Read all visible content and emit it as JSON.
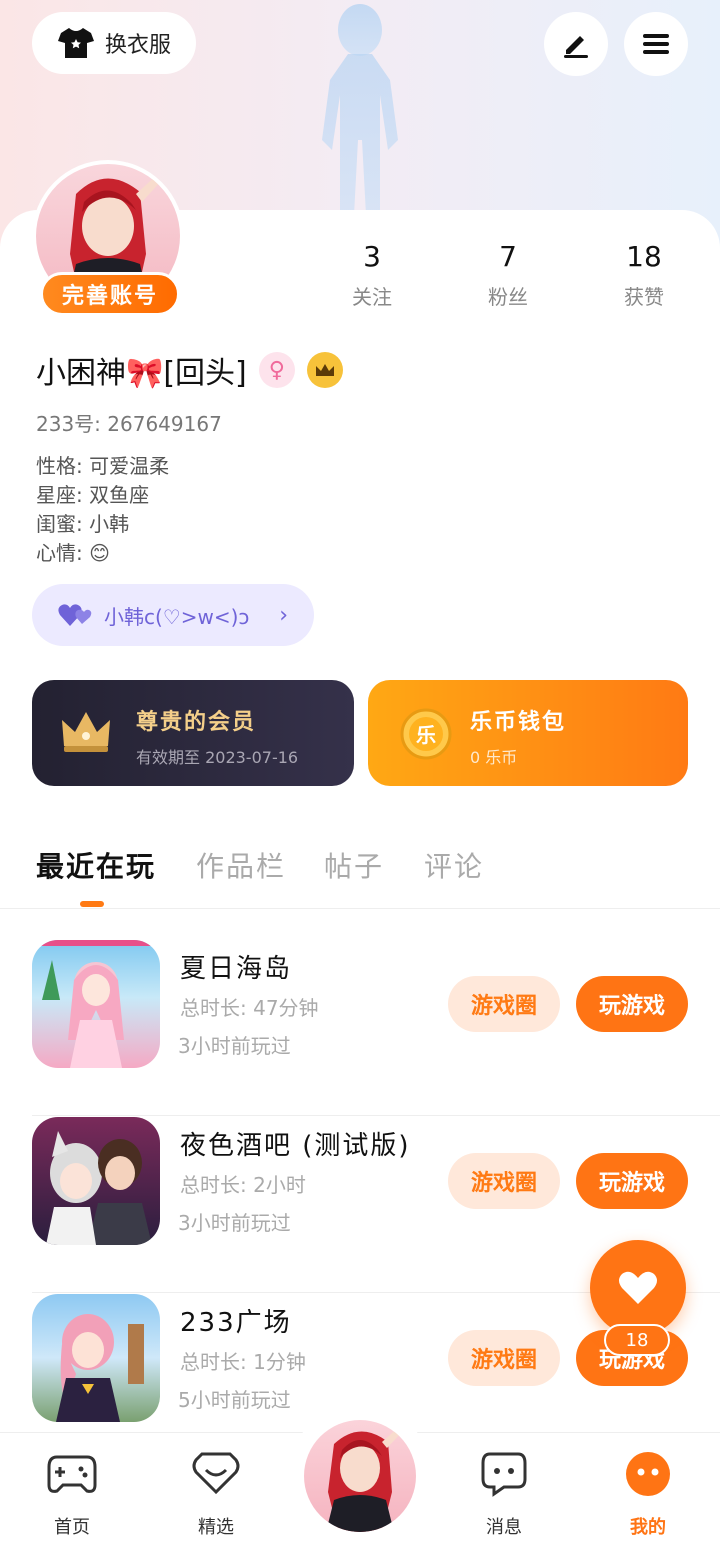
{
  "top_bar": {
    "dress_label": "换衣服"
  },
  "profile": {
    "badge": "完善账号",
    "stats": [
      {
        "value": "3",
        "label": "关注"
      },
      {
        "value": "7",
        "label": "粉丝"
      },
      {
        "value": "18",
        "label": "获赞"
      }
    ],
    "name": "小困神🎀[回头]",
    "gender_symbol": "♀",
    "uid_line": "233号: 267649167",
    "info": [
      "性格: 可爱温柔",
      "星座: 双鱼座",
      "闺蜜: 小韩",
      "心情: 😊"
    ],
    "friend_chip": "小韩c(♡>w<)ɔ",
    "chevron": "›"
  },
  "vip": {
    "title": "尊贵的会员",
    "subtitle": "有效期至 2023-07-16"
  },
  "wallet": {
    "coin_glyph": "乐",
    "title": "乐币钱包",
    "subtitle": "0 乐币"
  },
  "tabs": [
    "最近在玩",
    "作品栏",
    "帖子",
    "评论"
  ],
  "games": [
    {
      "name": "夏日海岛",
      "total": "总时长: 47分钟",
      "last": "3小时前玩过",
      "circle_btn": "游戏圈",
      "play_btn": "玩游戏"
    },
    {
      "name": "夜色酒吧 (测试版)",
      "total": "总时长: 2小时",
      "last": "3小时前玩过",
      "circle_btn": "游戏圈",
      "play_btn": "玩游戏"
    },
    {
      "name": "233广场",
      "total": "总时长: 1分钟",
      "last": "5小时前玩过",
      "circle_btn": "游戏圈",
      "play_btn": "玩游戏"
    }
  ],
  "like_fab": {
    "count": "18"
  },
  "bottom_nav": [
    {
      "label": "首页",
      "icon": "gamepad-icon"
    },
    {
      "label": "精选",
      "icon": "heart-box-icon"
    },
    {
      "label": "消息",
      "icon": "chat-icon"
    },
    {
      "label": "我的",
      "icon": "smile-icon"
    }
  ],
  "colors": {
    "accent": "#ff7414",
    "vip_bg": "#232131",
    "vip_text": "#f4cf8a",
    "friend_chip_bg": "#eceaff"
  }
}
